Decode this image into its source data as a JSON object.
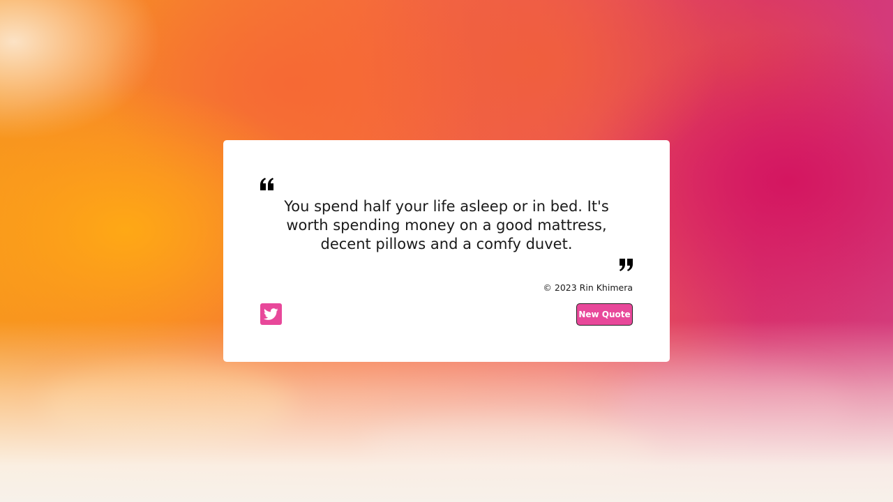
{
  "quote": {
    "text": "You spend half your life asleep or in bed. It's worth spending money on a good mattress, decent pillows and a comfy duvet.",
    "author": "© 2023 Rin Khimera"
  },
  "actions": {
    "new_quote_label": "New Quote",
    "tweet_icon": "twitter-icon"
  },
  "colors": {
    "accent": "#e8489a",
    "card": "#ffffff",
    "text": "#1a1a1a"
  }
}
